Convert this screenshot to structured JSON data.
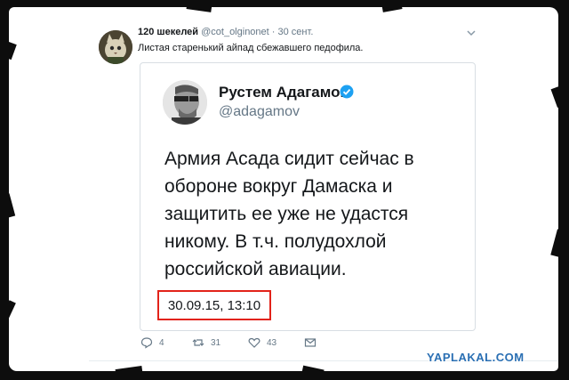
{
  "tweet": {
    "author_name": "120 шекелей",
    "author_handle": "@cot_olginonet",
    "separator": "·",
    "date": "30 сент.",
    "text": "Листая старенький айпад сбежавшего педофила."
  },
  "quoted": {
    "name": "Рустем Адагамов",
    "handle": "@adagamov",
    "body_lines": [
      "Армия Асада сидит сейчас в",
      "обороне вокруг Дамаска и",
      "защитить ее уже не удастся",
      "никому. В т.ч. полудохлой",
      "российской авиации."
    ],
    "timestamp": "30.09.15, 13:10",
    "highlight_color": "#e2231a"
  },
  "actions": {
    "reply_count": "4",
    "retweet_count": "31",
    "like_count": "43"
  },
  "icons": [
    "chevron-down-icon",
    "verified-badge-icon",
    "reply-icon",
    "retweet-icon",
    "like-icon",
    "direct-message-icon"
  ],
  "colors": {
    "accent": "#1da1f2",
    "secondary_text": "#657786",
    "watermark": "#2a6fb3"
  },
  "watermark": "YAPLAKAL.COM"
}
